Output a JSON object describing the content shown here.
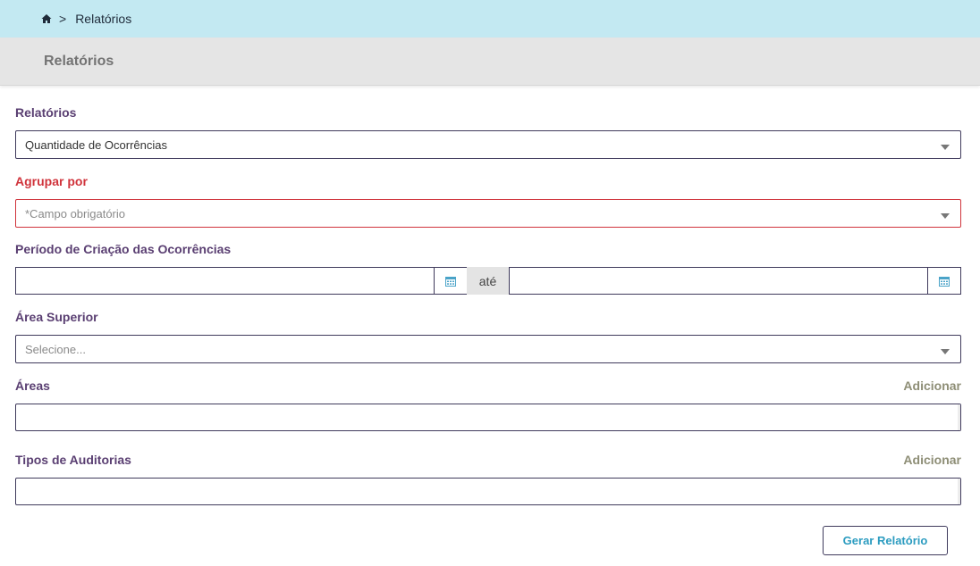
{
  "breadcrumb": {
    "home_icon": "home-icon",
    "separator": ">",
    "current": "Relatórios"
  },
  "header": {
    "title": "Relatórios"
  },
  "form": {
    "relatorios": {
      "label": "Relatórios",
      "value": "Quantidade de Ocorrências"
    },
    "agrupar": {
      "label": "Agrupar por",
      "placeholder": "*Campo obrigatório"
    },
    "periodo": {
      "label": "Período de Criação das Ocorrências",
      "between_label": "até",
      "start_value": "",
      "end_value": ""
    },
    "area_superior": {
      "label": "Área Superior",
      "placeholder": "Selecione..."
    },
    "areas": {
      "label": "Áreas",
      "add_label": "Adicionar"
    },
    "tipos_auditorias": {
      "label": "Tipos de Auditorias",
      "add_label": "Adicionar"
    },
    "submit_label": "Gerar Relatório"
  },
  "colors": {
    "breadcrumb_bg": "#c3e9f2",
    "header_bg": "#e5e5e5",
    "label": "#5a3f72",
    "required": "#d0343c",
    "link": "#8e8e76",
    "button_text": "#2c9cc0"
  }
}
